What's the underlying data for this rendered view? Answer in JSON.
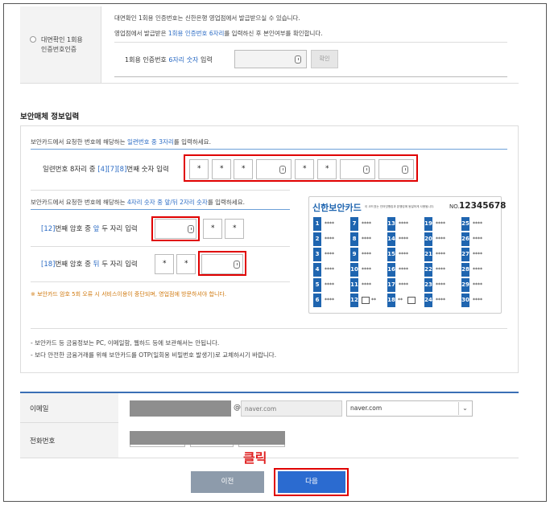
{
  "auth": {
    "radio_label_line1": "대면확인 1회용",
    "radio_label_line2": "인증번호인증",
    "desc1": "대면확인 1회용 인증번호는 신한은행 영업점에서 발급받으실 수 있습니다.",
    "desc2_pre": "영업점에서 발급받은 ",
    "desc2_hl": "1회용 인증번호 6자리",
    "desc2_post": "를 입력하신 후 본인여부를 확인합니다.",
    "input_label_pre": "1회용 인증번호 ",
    "input_label_hl": "6자리 숫자",
    "input_label_post": " 입력",
    "confirm_button": "확인"
  },
  "security": {
    "section_title": "보안매체 정보입력",
    "serial_desc_pre": "보안카드에서 요청한 번호에 해당하는 ",
    "serial_desc_hl": "일련번호 중 3자리",
    "serial_desc_post": "를 입력하세요.",
    "serial_label_pre": "일련번호 8자리 중 ",
    "serial_label_hl": "[4][7][8]",
    "serial_label_post": "번째 숫자 입력",
    "pw_desc_pre": "보안카드에서 요청한 번호에 해당하는 ",
    "pw_desc_hl": "4자리 숫자 중 앞/뒤 2자리 숫자",
    "pw_desc_post": "를 입력하세요.",
    "row1_label_hl1": "[12]",
    "row1_label_mid": "번째 암호 중 ",
    "row1_label_hl2": "앞",
    "row1_label_post": " 두 자리 입력",
    "row2_label_hl1": "[18]",
    "row2_label_mid": "번째 암호 중 ",
    "row2_label_hl2": "뒤",
    "row2_label_post": " 두 자리 입력",
    "warning": "※ 보안카드 암호 5회 오류 시 서비스이용이 중단되며, 영업점에 방문하셔야 합니다.",
    "note1": "- 보안카드 등 금융정보는 PC, 이메일함, 웹하드 등에 보관해서는 안됩니다.",
    "note2": "- 보다 안전한 금융거래를 위해 보안카드를 OTP(일회용 비밀번호 발생기)로 교체하시기 바랍니다.",
    "masked_star": "*"
  },
  "card": {
    "title": "신한보안카드",
    "subtitle": "이 코드표는 인터넷뱅킹과 폰뱅킹에 동일하게 사용됩니다.",
    "no_label": "NO.",
    "no_value": "12345678",
    "stars": "****",
    "partial_a": "**",
    "columns": [
      [
        1,
        2,
        3,
        4,
        5,
        6
      ],
      [
        7,
        8,
        9,
        10,
        11,
        12
      ],
      [
        13,
        14,
        15,
        16,
        17,
        18
      ],
      [
        19,
        20,
        21,
        22,
        23,
        24
      ],
      [
        25,
        26,
        27,
        28,
        29,
        30
      ]
    ]
  },
  "contact": {
    "email_label": "이메일",
    "at": "@",
    "domain_placeholder": "naver.com",
    "domain_selected": "naver.com",
    "phone_label": "전화번호"
  },
  "buttons": {
    "annotation": "클릭",
    "prev": "이전",
    "next": "다음"
  },
  "colors": {
    "accent": "#2b6bc4",
    "card_blue": "#1f65b0",
    "highlight_red": "#e00000",
    "prev_button": "#8d9bab",
    "next_button": "#2b6bd0"
  }
}
